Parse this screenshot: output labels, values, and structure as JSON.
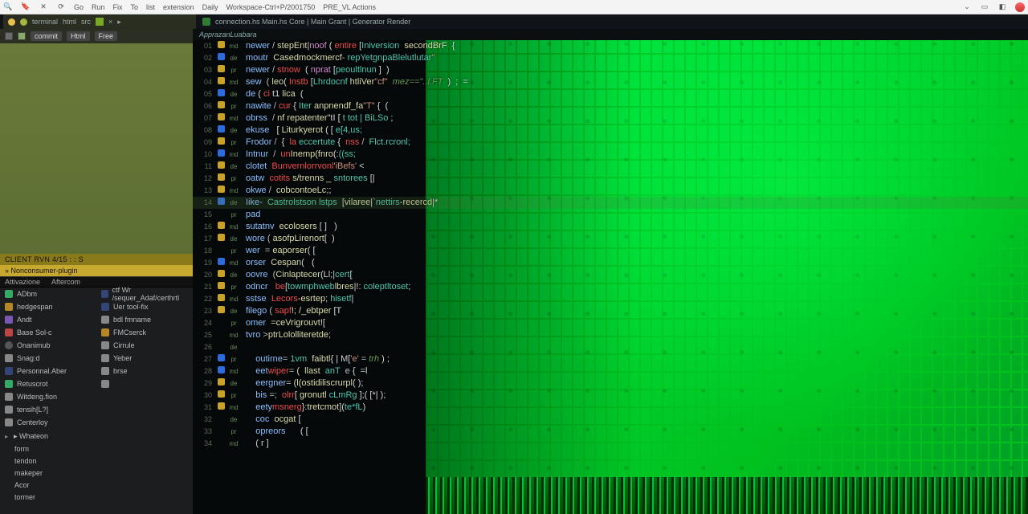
{
  "osbar": {
    "items": [
      "Go",
      "Run",
      "Fix",
      "To",
      "list",
      "extension",
      "Daily",
      "Workspace-Ctrl+P/2001750",
      "PRE_VL Actions"
    ],
    "right_icons": [
      "caret-down-icon",
      "minimize-icon",
      "restore-icon",
      "user-avatar-icon"
    ]
  },
  "appbar": {
    "left": {
      "dots": [
        "#e9c04a",
        "#a6b63a"
      ],
      "labels": [
        "terminal",
        "html",
        "src"
      ],
      "close": "×"
    },
    "right": {
      "tabtitle": "connection.hs  Main.hs  Core | Main  Grant | Generator Render"
    }
  },
  "sidebar": {
    "toolbar": {
      "label1": "commit",
      "label2": "Html",
      "label3": "Free"
    },
    "hdr": "CLIENT   RVN  4/15 :  :  S",
    "hdr2": "» Nonconsumer-plugin",
    "panelhead": [
      "Attivazione",
      "Aftercom"
    ],
    "left_items": [
      {
        "ic": "green",
        "label": "ADbm"
      },
      {
        "ic": "orange",
        "label": "hedgespan"
      },
      {
        "ic": "purple",
        "label": "Andt"
      },
      {
        "ic": "red",
        "label": "Base  Sol-c"
      },
      {
        "ic": "dot",
        "label": "Onanimub"
      },
      {
        "ic": "gray",
        "label": "Snag:d"
      },
      {
        "ic": "blue",
        "label": "Personnal.Aber"
      },
      {
        "ic": "green",
        "label": "Retuscrot"
      },
      {
        "ic": "gray",
        "label": "Witdeng.fion"
      },
      {
        "ic": "gray",
        "label": "tensih[L?]"
      },
      {
        "ic": "gray",
        "label": "Centerloy"
      }
    ],
    "right_items": [
      {
        "ic": "blue",
        "label": "ctf  Wr  /sequer_Adaf/certhrtl"
      },
      {
        "ic": "blue",
        "label": "Uer   tool-fix"
      },
      {
        "ic": "gray",
        "label": "bdl  fmname"
      },
      {
        "ic": "orange",
        "label": "FMCserck"
      },
      {
        "ic": "gray",
        "label": "Cirrule"
      },
      {
        "ic": "gray",
        "label": "Yeber"
      },
      {
        "ic": "gray",
        "label": "brse"
      },
      {
        "ic": "gray",
        "label": ""
      }
    ],
    "tree_header": "▸ Whateon",
    "tree": [
      "form",
      "tendon",
      "makeper",
      "Acor",
      "tormer"
    ]
  },
  "editor": {
    "crumb": "ApprazanLuabara",
    "active_line_index": 13,
    "lines": [
      {
        "n": "01",
        "g": "y",
        "code": [
          [
            "kw",
            "newer"
          ],
          [
            "op",
            " / "
          ],
          [
            "fn",
            "stepEnt"
          ],
          [
            "pun",
            "|"
          ],
          [
            "kw2",
            "noof"
          ],
          [
            "pun",
            " ( "
          ],
          [
            "err",
            "entire"
          ],
          [
            "pun",
            " ["
          ],
          [
            "type",
            "Iniversion"
          ],
          [
            "op",
            "  "
          ],
          [
            "fn",
            "secondBrF"
          ],
          [
            "pun",
            "  {"
          ]
        ]
      },
      {
        "n": "02",
        "g": "b",
        "code": [
          [
            "kw",
            "moutr"
          ],
          [
            "op",
            "  "
          ],
          [
            "fn",
            "Casedmockmercf"
          ],
          [
            "op",
            "- "
          ],
          [
            "type",
            "repYetgnpaBlelutlutar"
          ],
          [
            "str",
            "\""
          ]
        ]
      },
      {
        "n": "03",
        "g": "y",
        "code": [
          [
            "kw",
            "newer"
          ],
          [
            "op",
            " / "
          ],
          [
            "err",
            "stnow"
          ],
          [
            "pun",
            "  ( "
          ],
          [
            "kw2",
            "nprat"
          ],
          [
            "pun",
            " ["
          ],
          [
            "type",
            "peoultlnun"
          ],
          [
            "pun",
            " ]  )"
          ]
        ]
      },
      {
        "n": "04",
        "g": "y",
        "code": [
          [
            "kw",
            "sew"
          ],
          [
            "op",
            "  ( "
          ],
          [
            "fn",
            "leo"
          ],
          [
            "pun",
            "( "
          ],
          [
            "err",
            "Instb"
          ],
          [
            "pun",
            " ["
          ],
          [
            "type",
            "Lhrdocnf"
          ],
          [
            "fn",
            " htliVer"
          ],
          [
            "str",
            "\"cf\""
          ],
          [
            "cm",
            "  mez==\"..l.FT "
          ],
          [
            "pun",
            " )  ;  ="
          ]
        ]
      },
      {
        "n": "05",
        "g": "b",
        "code": [
          [
            "kw",
            "de"
          ],
          [
            "pun",
            " ( "
          ],
          [
            "err",
            "ci"
          ],
          [
            "pun",
            " t1 "
          ],
          [
            "fn",
            "lica"
          ],
          [
            "pun",
            "  ("
          ]
        ]
      },
      {
        "n": "06",
        "g": "y",
        "code": [
          [
            "kw",
            "nawite"
          ],
          [
            "op",
            " / "
          ],
          [
            "err",
            "cur"
          ],
          [
            "pun",
            " { "
          ],
          [
            "type",
            "Iter"
          ],
          [
            "fn",
            " anpnendf_fa"
          ],
          [
            "str",
            "\"T\""
          ],
          [
            "pun",
            " {  ("
          ]
        ]
      },
      {
        "n": "07",
        "g": "y",
        "code": [
          [
            "kw",
            "obrss"
          ],
          [
            "op",
            "  / "
          ],
          [
            "fn",
            "nf repatenter"
          ],
          [
            "pun",
            "\"tI [ "
          ],
          [
            "type",
            "t tot | BiLSo"
          ],
          [
            "pun",
            " ;"
          ]
        ]
      },
      {
        "n": "08",
        "g": "b",
        "code": [
          [
            "kw",
            "ekuse"
          ],
          [
            "op",
            "   "
          ],
          [
            "pun",
            "[ "
          ],
          [
            "fn",
            "Liturkyerot"
          ],
          [
            "pun",
            " ( [ "
          ],
          [
            "type",
            "e[4,us;"
          ]
        ]
      },
      {
        "n": "09",
        "g": "y",
        "code": [
          [
            "kw",
            "Frodor"
          ],
          [
            "op",
            " /  "
          ],
          [
            "pun",
            "{  "
          ],
          [
            "err",
            "la"
          ],
          [
            "type",
            " eccertute"
          ],
          [
            "pun",
            " {"
          ],
          [
            "err",
            "  nss"
          ],
          [
            "op",
            " /  "
          ],
          [
            "type",
            "Flct.rcronl;"
          ]
        ]
      },
      {
        "n": "10",
        "g": "b",
        "code": [
          [
            "kw",
            "Intnur"
          ],
          [
            "op",
            "  / "
          ],
          [
            "err",
            " un"
          ],
          [
            "fn",
            "Inemp(fnro"
          ],
          [
            "pun",
            "(:"
          ],
          [
            "type",
            "((ss;"
          ]
        ]
      },
      {
        "n": "11",
        "g": "y",
        "code": [
          [
            "kw",
            "clotet"
          ],
          [
            "op",
            "  "
          ],
          [
            "err",
            "Bunvernlorrvonl"
          ],
          [
            "str",
            "'iBefs'"
          ],
          [
            "pun",
            " <"
          ]
        ]
      },
      {
        "n": "12",
        "g": "y",
        "code": [
          [
            "kw",
            "oatw"
          ],
          [
            "op",
            "  "
          ],
          [
            "err",
            "cotits"
          ],
          [
            "fn",
            " s/trenns _ "
          ],
          [
            "type",
            "sntorees"
          ],
          [
            "pun",
            " [|"
          ]
        ]
      },
      {
        "n": "13",
        "g": "y",
        "code": [
          [
            "kw",
            "okwe"
          ],
          [
            "op",
            " /  "
          ],
          [
            "fn",
            "cobcontoeLc"
          ],
          [
            "pun",
            ";;"
          ]
        ]
      },
      {
        "n": "14",
        "g": "b",
        "code": [
          [
            "kw",
            "Iike-"
          ],
          [
            "op",
            "  "
          ],
          [
            "type",
            "Castrolstson lstps"
          ],
          [
            "pun",
            "  ["
          ],
          [
            "fn",
            "vilaree"
          ],
          [
            "pun",
            "|`"
          ],
          [
            "type",
            "nettirs"
          ],
          [
            "fn",
            "-recercd"
          ],
          [
            "pun",
            "|*"
          ]
        ]
      },
      {
        "n": "15",
        "g": "",
        "code": [
          [
            "kw",
            "pad"
          ]
        ]
      },
      {
        "n": "16",
        "g": "y",
        "code": [
          [
            "kw",
            "sutatnv"
          ],
          [
            "op",
            "  "
          ],
          [
            "fn",
            "ecolosers"
          ],
          [
            "pun",
            " [ ]   )"
          ]
        ]
      },
      {
        "n": "17",
        "g": "y",
        "code": [
          [
            "kw",
            "wore"
          ],
          [
            "op",
            " ( "
          ],
          [
            "fn",
            "asofpLirenort"
          ],
          [
            "pun",
            "[  )"
          ]
        ]
      },
      {
        "n": "18",
        "g": "",
        "code": [
          [
            "kw",
            "wer"
          ],
          [
            "op",
            "  = "
          ],
          [
            "fn",
            "eaporser"
          ],
          [
            "pun",
            "( ["
          ]
        ]
      },
      {
        "n": "19",
        "g": "b",
        "code": [
          [
            "kw",
            "orser"
          ],
          [
            "op",
            "  "
          ],
          [
            "fn",
            "Cespan"
          ],
          [
            "pun",
            "(   ("
          ]
        ]
      },
      {
        "n": "20",
        "g": "y",
        "code": [
          [
            "kw",
            "oovre"
          ],
          [
            "op",
            "  ("
          ],
          [
            "fn",
            "Cinlaptecer"
          ],
          [
            "pun",
            "(Ll;|"
          ],
          [
            "type",
            "cert"
          ],
          [
            "pun",
            "["
          ]
        ]
      },
      {
        "n": "21",
        "g": "y",
        "code": [
          [
            "kw",
            "odncr"
          ],
          [
            "op",
            "   "
          ],
          [
            "err",
            "be"
          ],
          [
            "pun",
            "["
          ],
          [
            "type",
            "towmphweb"
          ],
          [
            "fn",
            "lbres"
          ],
          [
            "pun",
            "|!: "
          ],
          [
            "type",
            "coleptltoset"
          ],
          [
            "pun",
            ";"
          ]
        ]
      },
      {
        "n": "22",
        "g": "y",
        "code": [
          [
            "kw",
            "sstse"
          ],
          [
            "op",
            "  "
          ],
          [
            "err",
            "Lecors"
          ],
          [
            "pun",
            "-"
          ],
          [
            "fn",
            "esrtep"
          ],
          [
            "pun",
            "; "
          ],
          [
            "type",
            "hisetf"
          ],
          [
            "pun",
            "|"
          ]
        ]
      },
      {
        "n": "23",
        "g": "y",
        "code": [
          [
            "kw",
            "filego"
          ],
          [
            "op",
            " ( "
          ],
          [
            "err",
            "sapf"
          ],
          [
            "fn",
            "!; /_ebtper"
          ],
          [
            "pun",
            " [T"
          ]
        ]
      },
      {
        "n": "24",
        "g": "",
        "code": [
          [
            "kw",
            "omer"
          ],
          [
            "op",
            "  "
          ],
          [
            "fn",
            "=ceVrigrouvt"
          ],
          [
            "pun",
            "!["
          ]
        ]
      },
      {
        "n": "25",
        "g": "",
        "code": [
          [
            "kw",
            "tvro"
          ],
          [
            "op",
            " >"
          ],
          [
            "fn",
            "ptrLololliteretde"
          ],
          [
            "pun",
            ";"
          ]
        ]
      },
      {
        "n": "26",
        "g": "",
        "code": [
          [
            "pun",
            "    "
          ]
        ]
      },
      {
        "n": "27",
        "g": "b",
        "code": [
          [
            "pun",
            "    "
          ],
          [
            "kw",
            "outirne"
          ],
          [
            "op",
            "= "
          ],
          [
            "type",
            "1vm"
          ],
          [
            "fn",
            "  faibtl"
          ],
          [
            "pun",
            "{ | M["
          ],
          [
            "str",
            "'e'"
          ],
          [
            "op",
            " ="
          ],
          [
            "cm",
            " trh"
          ],
          [
            "pun",
            " ) ;"
          ]
        ]
      },
      {
        "n": "28",
        "g": "b",
        "code": [
          [
            "pun",
            "    "
          ],
          [
            "kw",
            "eet"
          ],
          [
            "err",
            "wiper"
          ],
          [
            "op",
            "= "
          ],
          [
            "fn",
            "(  llast"
          ],
          [
            "type",
            "  anT"
          ],
          [
            "op",
            "  e "
          ],
          [
            "pun",
            "{  =l"
          ]
        ]
      },
      {
        "n": "29",
        "g": "y",
        "code": [
          [
            "pun",
            "    "
          ],
          [
            "kw",
            "eergner"
          ],
          [
            "op",
            "= "
          ],
          [
            "fn",
            "(l(ostidiliscrurpl"
          ],
          [
            "pun",
            "( );"
          ]
        ]
      },
      {
        "n": "30",
        "g": "y",
        "code": [
          [
            "pun",
            "    "
          ],
          [
            "kw",
            "bis"
          ],
          [
            "op",
            " =;  "
          ],
          [
            "err",
            "olrr"
          ],
          [
            "pun",
            "[ "
          ],
          [
            "fn",
            "gronutl"
          ],
          [
            "type",
            " cLmRg"
          ],
          [
            "pun",
            " ];( "
          ],
          [
            "pun",
            "[*| );"
          ]
        ]
      },
      {
        "n": "31",
        "g": "y",
        "code": [
          [
            "pun",
            "    "
          ],
          [
            "kw",
            "eety"
          ],
          [
            "err",
            "msnerg"
          ],
          [
            "pun",
            "}:"
          ],
          [
            "fn",
            "tretcmot"
          ],
          [
            "pun",
            "]("
          ],
          [
            "type",
            "te*fL"
          ],
          [
            "pun",
            ")"
          ]
        ]
      },
      {
        "n": "32",
        "g": "",
        "code": [
          [
            "pun",
            "    "
          ],
          [
            "kw",
            "coc"
          ],
          [
            "op",
            "  "
          ],
          [
            "fn",
            "ocgat"
          ],
          [
            "pun",
            " ["
          ]
        ]
      },
      {
        "n": "33",
        "g": "",
        "code": [
          [
            "pun",
            "    "
          ],
          [
            "kw",
            "opreors"
          ],
          [
            "pun",
            "      ( ["
          ]
        ]
      },
      {
        "n": "34",
        "g": "",
        "code": [
          [
            "pun",
            "    ( r ]"
          ]
        ]
      }
    ]
  }
}
